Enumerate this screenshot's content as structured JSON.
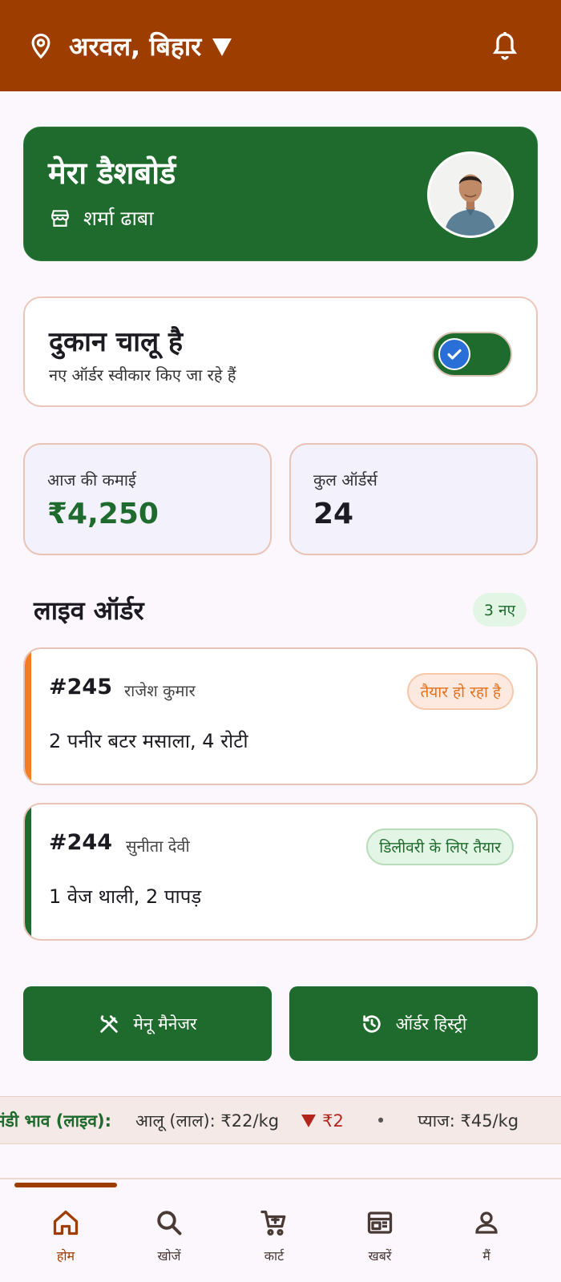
{
  "header": {
    "location": "अरवल, बिहार"
  },
  "dashboard": {
    "title": "मेरा डैशबोर्ड",
    "shop_name": "शर्मा ढाबा"
  },
  "shop_status": {
    "title": "दुकान चालू है",
    "subtitle": "नए ऑर्डर स्वीकार किए जा रहे हैं",
    "is_open": true
  },
  "stats": {
    "earnings_label": "आज की कमाई",
    "earnings_value": "₹4,250",
    "orders_label": "कुल ऑर्डर्स",
    "orders_value": "24"
  },
  "live_orders": {
    "title": "लाइव ऑर्डर",
    "new_badge": "3 नए",
    "orders": [
      {
        "id": "#245",
        "customer": "राजेश कुमार",
        "items": "2 पनीर बटर मसाला, 4 रोटी",
        "status": "तैयार हो रहा है",
        "status_color": "#e8711c"
      },
      {
        "id": "#244",
        "customer": "सुनीता देवी",
        "items": "1 वेज थाली, 2 पापड़",
        "status": "डिलीवरी के लिए तैयार",
        "status_color": "#1e6b2d"
      }
    ]
  },
  "actions": {
    "menu_manager": "मेनू मैनेजर",
    "order_history": "ऑर्डर हिस्ट्री"
  },
  "ticker": {
    "label": "मंडी भाव (लाइव):",
    "item1": "आलू (लाल): ₹22/kg",
    "item1_change": "₹2",
    "separator": "•",
    "item2": "प्याज: ₹45/kg"
  },
  "nav": {
    "home": "होम",
    "search": "खोजें",
    "cart": "कार्ट",
    "news": "खबरें",
    "me": "मैं"
  },
  "colors": {
    "primary": "#9e3d00",
    "green": "#1e6b2d",
    "orange": "#e8711c"
  }
}
